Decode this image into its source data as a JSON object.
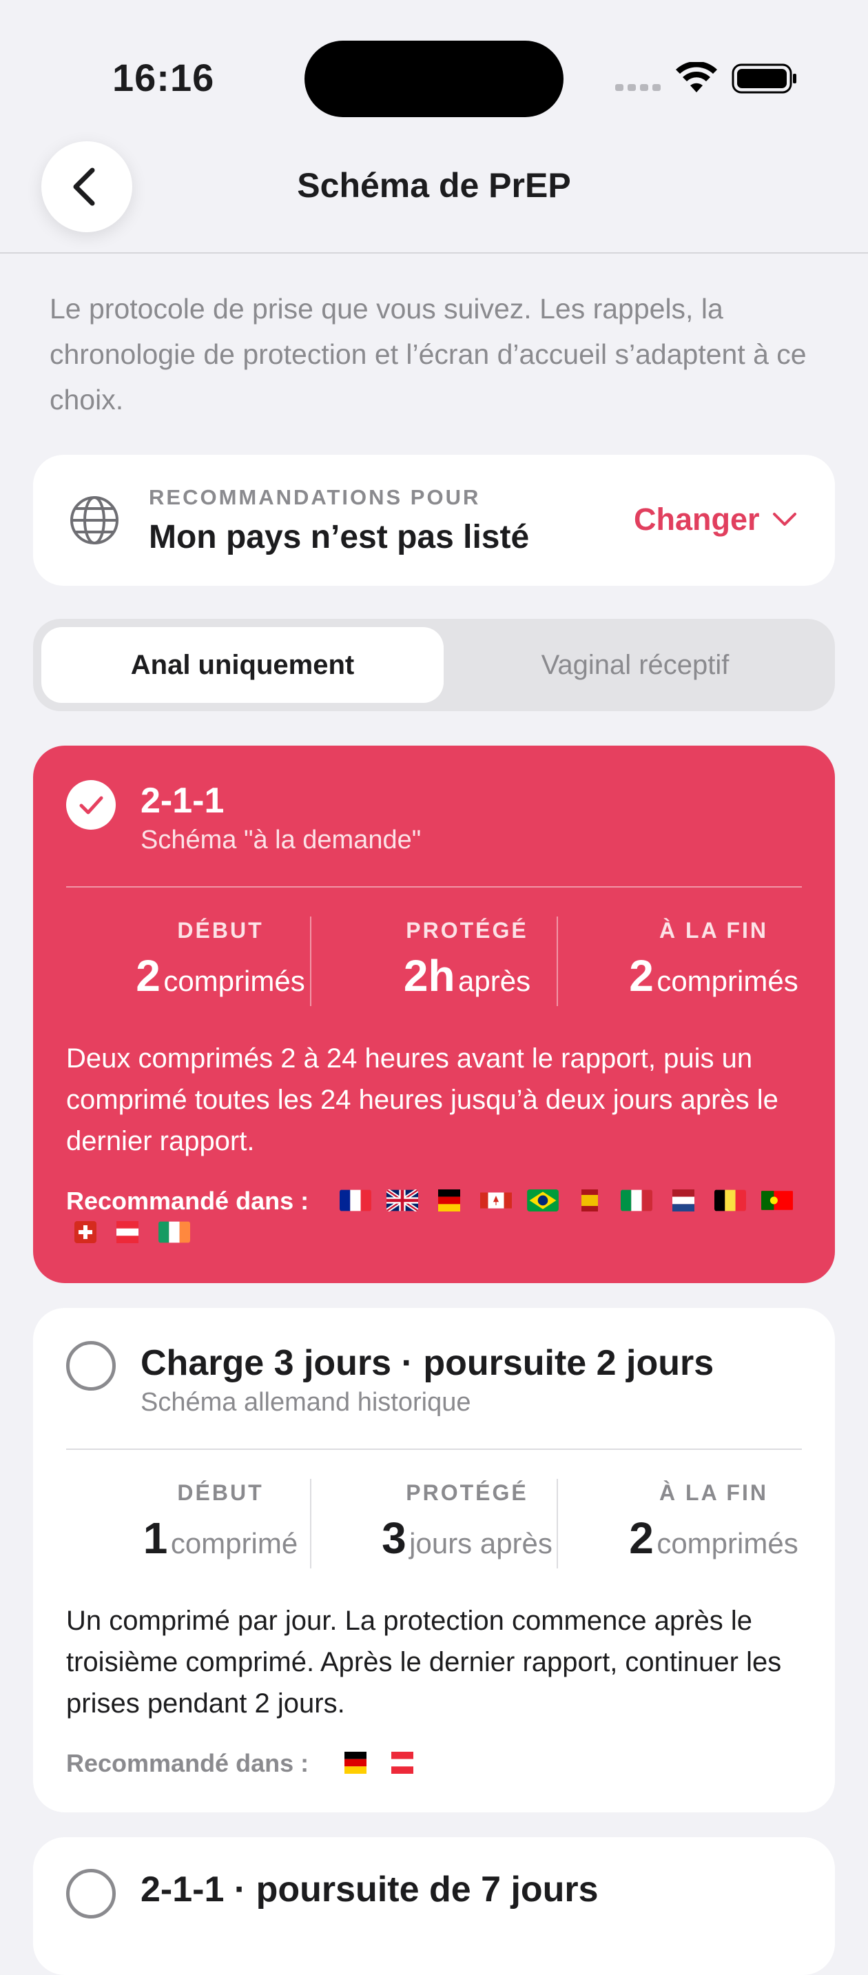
{
  "status_bar": {
    "time": "16:16"
  },
  "nav": {
    "title": "Schéma de PrEP"
  },
  "intro": "Le protocole de prise que vous suivez. Les rappels, la chronologie de protection et l’écran d’accueil s’adaptent à ce choix.",
  "country": {
    "label": "RECOMMANDATIONS POUR",
    "value": "Mon pays n’est pas listé",
    "change_label": "Changer"
  },
  "segments": {
    "active": "Anal uniquement",
    "inactive": "Vaginal réceptif"
  },
  "colors": {
    "accent": "#e6405f",
    "accent_text": "#e13f5e"
  },
  "regimens": [
    {
      "title": "2-1-1",
      "subtitle": "Schéma \"à la demande\"",
      "selected": true,
      "stats": [
        {
          "label": "DÉBUT",
          "num": "2",
          "unit": "comprimés"
        },
        {
          "label": "PROTÉGÉ",
          "num": "2h",
          "unit": "après"
        },
        {
          "label": "À LA FIN",
          "num": "2",
          "unit": "comprimés"
        }
      ],
      "description": "Deux comprimés 2 à 24 heures avant le rapport, puis un comprimé toutes les 24 heures jusqu’à deux jours après le dernier rapport.",
      "recommended_label": "Recommandé dans :",
      "flags": [
        "FR",
        "GB",
        "DE",
        "CA",
        "BR",
        "ES",
        "IT",
        "NL",
        "BE",
        "PT",
        "CH",
        "AT",
        "IE"
      ]
    },
    {
      "title": "Charge 3 jours · poursuite 2 jours",
      "subtitle": "Schéma allemand historique",
      "selected": false,
      "stats": [
        {
          "label": "DÉBUT",
          "num": "1",
          "unit": "comprimé"
        },
        {
          "label": "PROTÉGÉ",
          "num": "3",
          "unit": "jours après"
        },
        {
          "label": "À LA FIN",
          "num": "2",
          "unit": "comprimés"
        }
      ],
      "description": "Un comprimé par jour. La protection commence après le troisième comprimé. Après le dernier rapport, continuer les prises pendant 2 jours.",
      "recommended_label": "Recommandé dans :",
      "flags": [
        "DE",
        "AT"
      ]
    },
    {
      "title": "2-1-1 · poursuite de 7 jours",
      "selected": false
    }
  ]
}
